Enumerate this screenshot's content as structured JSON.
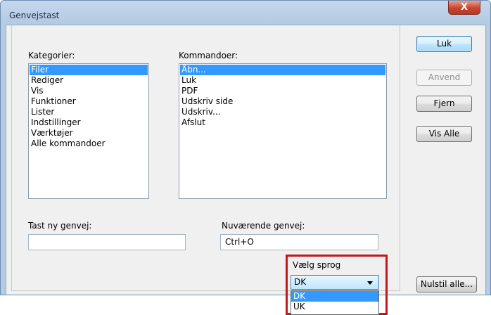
{
  "window": {
    "title": "Genvejstast",
    "close_icon_glyph": "X"
  },
  "categories": {
    "label": "Kategorier:",
    "items": [
      "Filer",
      "Rediger",
      "Vis",
      "Funktioner",
      "Lister",
      "Indstillinger",
      "Værktøjer",
      "Alle kommandoer"
    ],
    "selected": "Filer"
  },
  "commands": {
    "label": "Kommandoer:",
    "items": [
      "Åbn...",
      "Luk",
      "PDF",
      "Udskriv side",
      "Udskriv...",
      "Afslut"
    ],
    "selected": "Åbn..."
  },
  "new_shortcut": {
    "label": "Tast ny genvej:",
    "value": ""
  },
  "current_shortcut": {
    "label": "Nuværende genvej:",
    "value": "Ctrl+O"
  },
  "language": {
    "label": "Vælg sprog",
    "selected": "DK",
    "options": [
      "DK",
      "UK"
    ]
  },
  "buttons": {
    "close": "Luk",
    "apply": "Anvend",
    "remove": "Fjern",
    "show_all": "Vis Alle",
    "reset_all": "Nulstil alle..."
  },
  "colors": {
    "selection": "#3399ff",
    "highlight_frame": "#c4161c",
    "close_button": "#c8452e"
  }
}
